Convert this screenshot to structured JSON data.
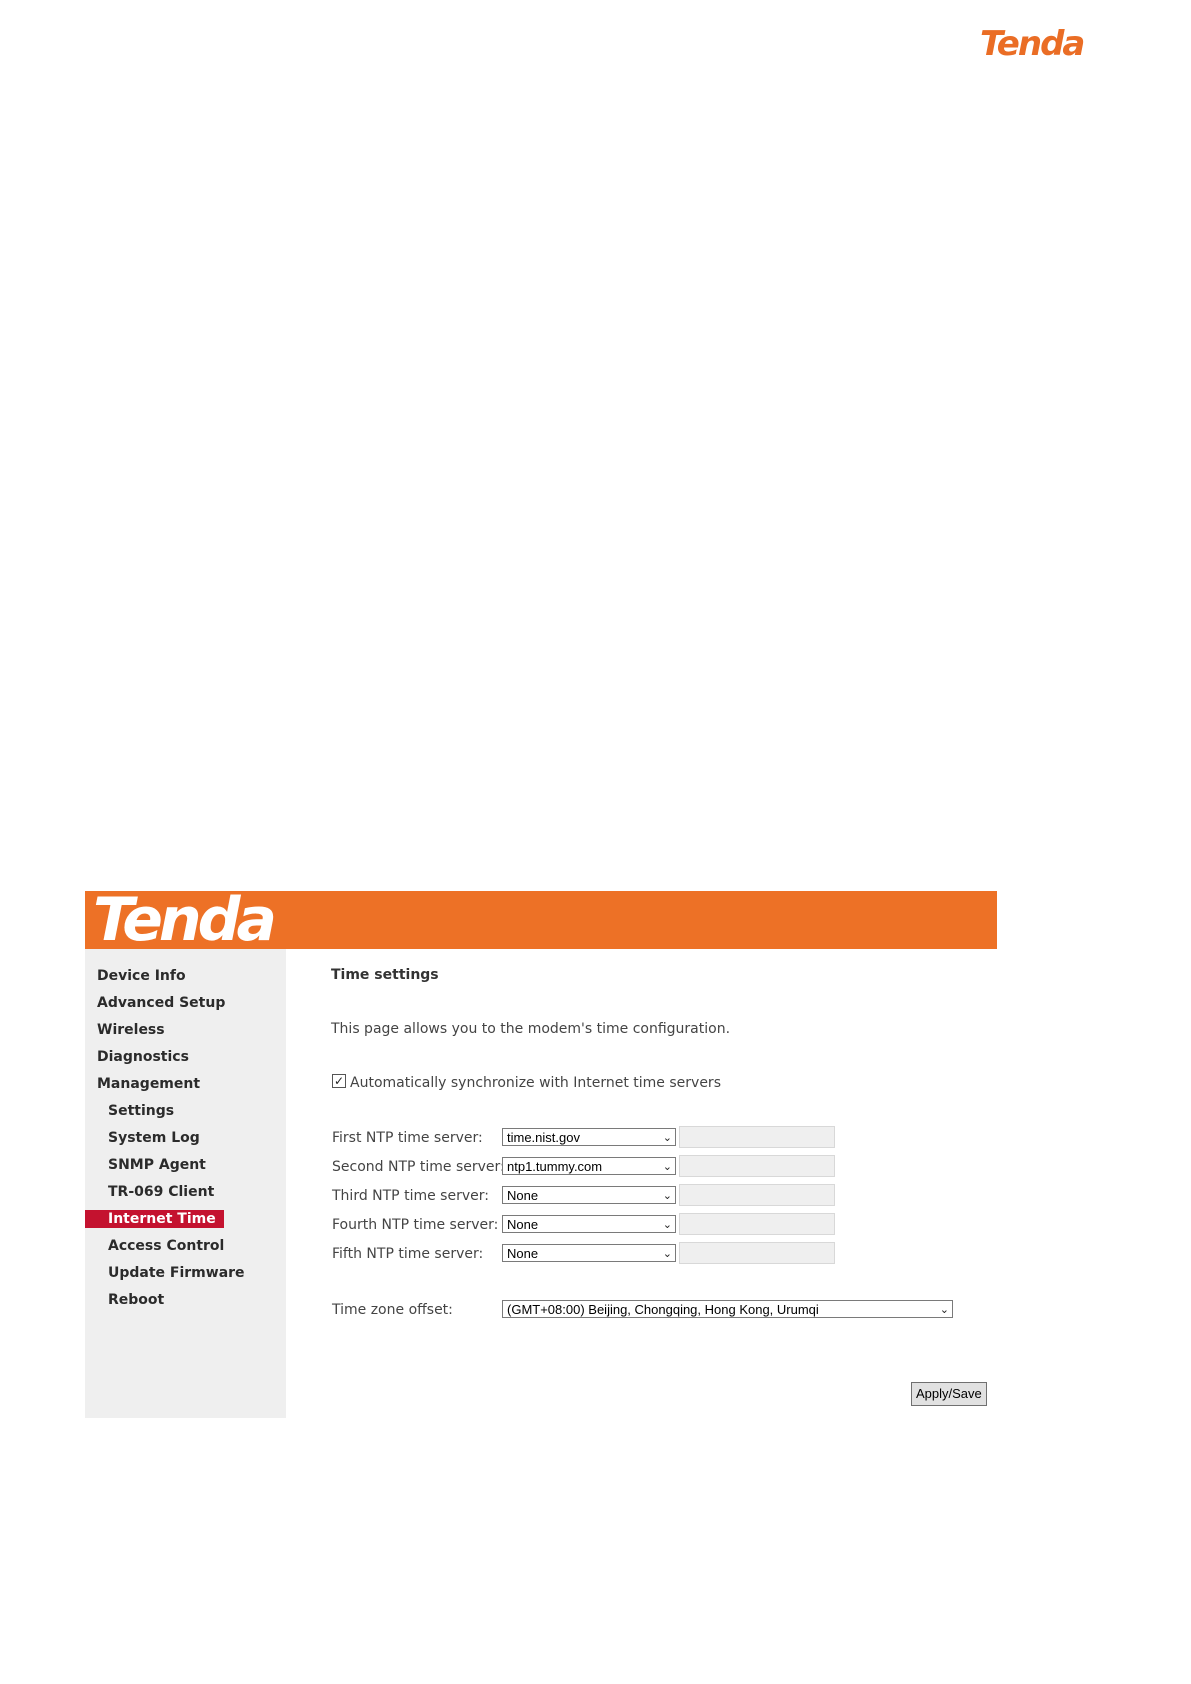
{
  "brand": {
    "name": "Tenda",
    "color": "#ed7126"
  },
  "sidebar": {
    "items": [
      {
        "label": "Device Info"
      },
      {
        "label": "Advanced Setup"
      },
      {
        "label": "Wireless"
      },
      {
        "label": "Diagnostics"
      },
      {
        "label": "Management"
      },
      {
        "label": "Settings"
      },
      {
        "label": "System Log"
      },
      {
        "label": "SNMP Agent"
      },
      {
        "label": "TR-069 Client"
      },
      {
        "label": "Internet Time",
        "active": true
      },
      {
        "label": "Access Control"
      },
      {
        "label": "Update Firmware"
      },
      {
        "label": "Reboot"
      }
    ],
    "active_color": "#c4122f"
  },
  "main": {
    "title": "Time settings",
    "description": "This page allows you to the modem's time configuration.",
    "auto_sync": {
      "label": "Automatically synchronize with Internet time servers",
      "checked": true
    },
    "ntp_servers": [
      {
        "label": "First NTP time server:",
        "value": "time.nist.gov"
      },
      {
        "label": "Second NTP time server:",
        "value": "ntp1.tummy.com"
      },
      {
        "label": "Third NTP time server:",
        "value": "None"
      },
      {
        "label": "Fourth NTP time server:",
        "value": "None"
      },
      {
        "label": "Fifth NTP time server:",
        "value": "None"
      }
    ],
    "timezone": {
      "label": "Time zone offset:",
      "value": "(GMT+08:00) Beijing, Chongqing, Hong Kong, Urumqi"
    },
    "apply_label": "Apply/Save"
  }
}
